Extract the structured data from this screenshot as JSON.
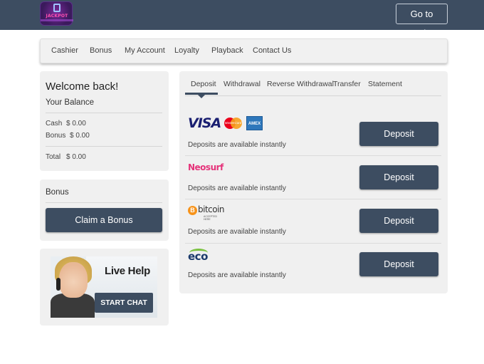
{
  "header": {
    "logo_text": "JACKPOT",
    "go_to_casino": "Go to Casino"
  },
  "nav": {
    "items": [
      "Cashier",
      "Bonus",
      "My Account",
      "Loyalty",
      "Playback",
      "Contact Us"
    ]
  },
  "welcome": {
    "title": "Welcome back!",
    "subtitle": "Your Balance",
    "cash_label": "Cash",
    "cash_value": "$ 0.00",
    "bonus_label": "Bonus",
    "bonus_value": "$ 0.00",
    "total_label": "Total",
    "total_value": "$ 0.00"
  },
  "bonus_panel": {
    "title": "Bonus",
    "button": "Claim a Bonus"
  },
  "live_help": {
    "title": "Live Help",
    "button": "START CHAT"
  },
  "tabs": [
    "Deposit",
    "Withdrawal",
    "Reverse Withdrawal",
    "Transfer",
    "Statement"
  ],
  "active_tab": "Deposit",
  "methods": [
    {
      "logo": "visa-mastercard-amex",
      "logo_text": [
        "VISA",
        "MasterCard",
        "AMEX"
      ],
      "note": "Deposits are available instantly",
      "button": "Deposit"
    },
    {
      "logo": "neosurf",
      "logo_text": "Neosurf",
      "note": "Deposits are available instantly",
      "button": "Deposit"
    },
    {
      "logo": "bitcoin",
      "logo_text": "bitcoin",
      "logo_sub": "ACCEPTED HERE",
      "note": "Deposits are available instantly",
      "button": "Deposit"
    },
    {
      "logo": "eco",
      "logo_text": "eco",
      "note": "Deposits are available instantly",
      "button": "Deposit"
    }
  ],
  "colors": {
    "header_bg": "#3d4d61",
    "button_bg": "#3d4d61",
    "panel_bg": "#f0f0f0"
  }
}
